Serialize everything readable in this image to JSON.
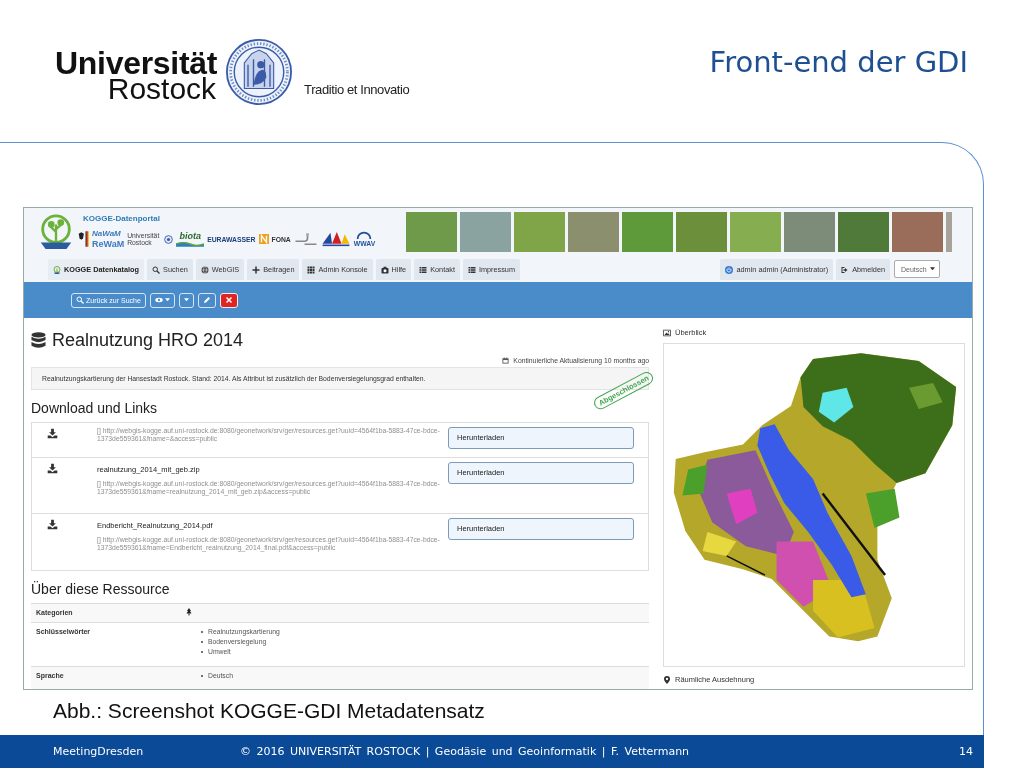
{
  "slide_header": {
    "logo": {
      "line_1": "Universität",
      "line_2": "Rostock",
      "motto": "Traditio et Innovatio"
    },
    "title": "Front-end der GDI"
  },
  "screenshot": {
    "portal_header": {
      "site_name": "KOGGE-Datenportal",
      "partner_logos": [
        "NaWaM",
        "ReWaM",
        "Universität Rostock",
        "biota",
        "EURAWASSER",
        "FONA",
        "WWAV"
      ]
    },
    "nav_tabs": [
      {
        "label": "KOGGE Datenkatalog",
        "selected": true
      },
      {
        "label": "Suchen",
        "selected": false
      },
      {
        "label": "WebGIS",
        "selected": false
      },
      {
        "label": "Beitragen",
        "selected": false
      },
      {
        "label": "Admin Konsole",
        "selected": false
      },
      {
        "label": "Hilfe",
        "selected": false
      },
      {
        "label": "Kontakt",
        "selected": false
      },
      {
        "label": "Impressum",
        "selected": false
      }
    ],
    "user_menu": {
      "account": "admin admin (Administrator)",
      "logout": "Abmelden",
      "language": "Deutsch"
    },
    "toolbar": {
      "back_button": "Zurück zur Suche"
    },
    "record": {
      "title": "Realnutzung HRO 2014",
      "update_info": "Kontinuierliche Aktualisierung 10 months ago",
      "abstract": "Realnutzungskartierung der Hansestadt Rostock. Stand: 2014. Als Attribut ist zusätzlich der Bodenversiegelungsgrad enthalten.",
      "status_stamp": "Abgeschlossen"
    },
    "downloads": {
      "heading": "Download und Links",
      "items": [
        {
          "url": "[] http://webgis-kogge.auf.uni-rostock.de:8080/geonetwork/srv/ger/resources.get?uuid=4564f1ba-5883-47ce-bdce-1373de559361&fname=&access=public",
          "button": "Herunterladen"
        },
        {
          "name": "realnutzung_2014_mit_geb.zip",
          "url": "[] http://webgis-kogge.auf.uni-rostock.de:8080/geonetwork/srv/ger/resources.get?uuid=4564f1ba-5883-47ce-bdce-1373de559361&fname=realnutzung_2014_mit_geb.zip&access=public",
          "button": "Herunterladen"
        },
        {
          "name": "Endbericht_Realnutzung_2014.pdf",
          "url": "[] http://webgis-kogge.auf.uni-rostock.de:8080/geonetwork/srv/ger/resources.get?uuid=4564f1ba-5883-47ce-bdce-1373de559361&fname=Endbericht_realnutzung_2014_final.pdf&access=public",
          "button": "Herunterladen"
        }
      ]
    },
    "about": {
      "heading": "Über diese Ressource",
      "rows": [
        {
          "kind": "icon",
          "label": "Kategorien"
        },
        {
          "kind": "list",
          "label": "Schlüsselwörter",
          "values": [
            "Realnutzungskartierung",
            "Bodenversiegelung",
            "Umwelt"
          ]
        },
        {
          "kind": "list",
          "label": "Sprache",
          "values": [
            "Deutsch"
          ]
        }
      ]
    },
    "overview": {
      "heading": "Überblick"
    },
    "extent": {
      "heading": "Räumliche Ausdehnung"
    }
  },
  "caption": "Abb.: Screenshot KOGGE-GDI Metadatensatz",
  "footer": {
    "event": "MeetingDresden",
    "copyright": "© 2016 UNIVERSITÄT ROSTOCK | Geodäsie und Geoinformatik | F. Vettermann",
    "page": "14"
  }
}
